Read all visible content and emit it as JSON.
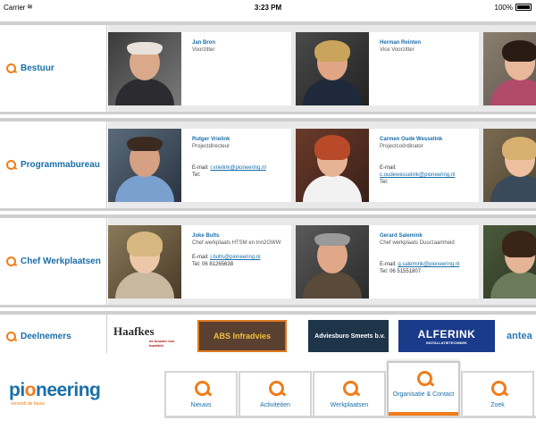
{
  "statusbar": {
    "carrier": "Carrier",
    "time": "3:23 PM",
    "battery": "100%"
  },
  "sections": {
    "bestuur": {
      "label": "Bestuur",
      "people": [
        {
          "name": "Jan Bron",
          "role": "Voorzitter"
        },
        {
          "name": "Herman Reinten",
          "role": "Vice Voorzitter"
        }
      ]
    },
    "programmabureau": {
      "label": "Programmabureau",
      "people": [
        {
          "name": "Rutger Vrielink",
          "role": "Projectdirecteur",
          "email_label": "E-mail:",
          "email": "r.vrielink@pioneering.nl",
          "tel_label": "Tel:",
          "tel": ""
        },
        {
          "name": "Carmen Oude Wesselink",
          "role": "Projectcoördinator",
          "email_label": "E-mail:",
          "email": "c.oudewesselink@pioneering.nl",
          "tel_label": "Tel:",
          "tel": ""
        }
      ]
    },
    "werkplaatsen": {
      "label": "Chef Werkplaatsen",
      "people": [
        {
          "name": "Joke Bults",
          "role": "Chef werkplaats HTSM en Inn2GWW",
          "email_label": "E-mail:",
          "email": "j.bults@pioneering.nl",
          "tel_label": "Tel:",
          "tel": "06 81265638"
        },
        {
          "name": "Gerard Salemink",
          "role": "Chef werkplaats Duurzaamheid",
          "email_label": "E-mail:",
          "email": "g.salemink@pioneering.nl",
          "tel_label": "Tel:",
          "tel": "06 51551807"
        }
      ]
    },
    "deelnemers": {
      "label": "Deelnemers",
      "logos": [
        {
          "text": "Haafkes",
          "sub": "de bouwer van kwaliteit"
        },
        {
          "text": "ABS Infradvies",
          "sub": ""
        },
        {
          "text": "Adviesburo Smeets b.v.",
          "sub": ""
        },
        {
          "text": "ALFERINK",
          "sub": "INSTALLATIETECHNIEK"
        },
        {
          "text": "antea",
          "sub": ""
        }
      ]
    }
  },
  "brand": {
    "word_a": "pi",
    "word_o": "o",
    "word_b": "neering",
    "tagline": "versnelt de bouw"
  },
  "tabs": [
    {
      "label": "Nieuws",
      "active": false
    },
    {
      "label": "Activiteiten",
      "active": false
    },
    {
      "label": "Werkplaatsen",
      "active": false
    },
    {
      "label": "Organisatie & Contact",
      "active": true
    },
    {
      "label": "Zoek",
      "active": false
    }
  ],
  "colors": {
    "accent": "#f07d1a",
    "brand_blue": "#1a6fa8",
    "divider": "#cfcfcf"
  }
}
